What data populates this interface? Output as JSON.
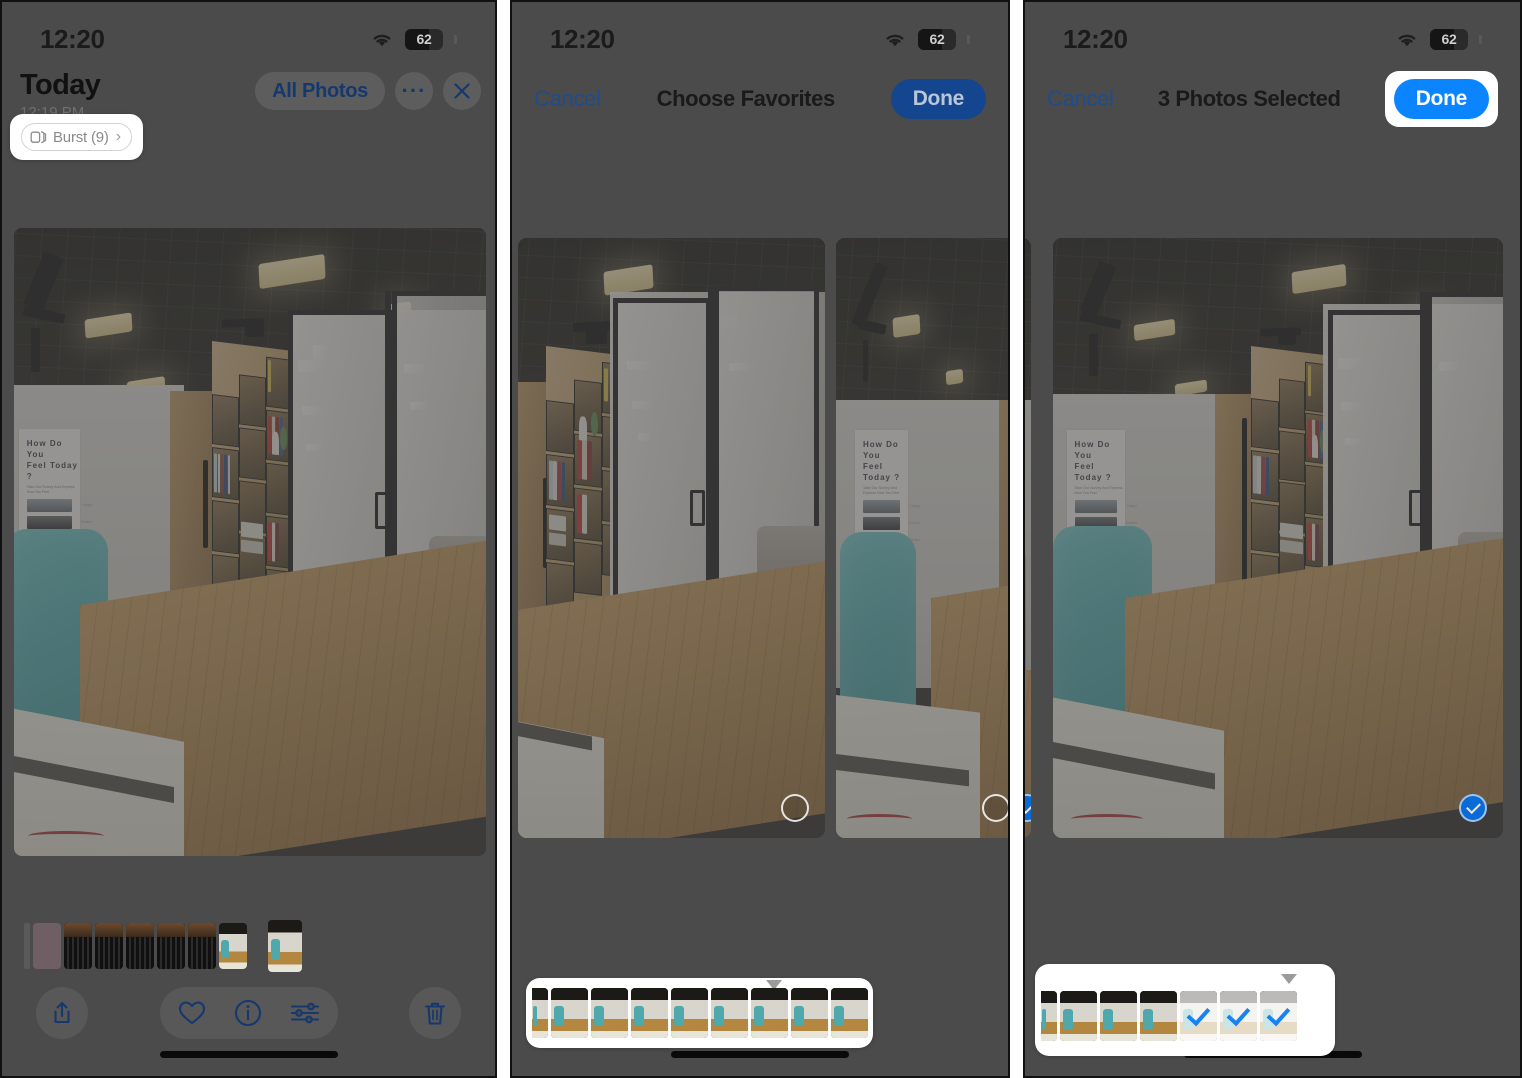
{
  "meta": {
    "app": "Photos",
    "platform": "iOS",
    "panel_count": 3
  },
  "status_bar": {
    "time": "12:20",
    "wifi_icon": "wifi-icon",
    "battery_icon": "battery-icon",
    "battery_level": "62"
  },
  "panel1": {
    "title": "Today",
    "subtitle": "12:19 PM",
    "all_photos_label": "All Photos",
    "more_label": "···",
    "close_label": "✕",
    "burst_badge": {
      "label": "Burst (9)",
      "icon": "burst-stack-icon",
      "chevron": "›",
      "highlighted": true
    },
    "toolbar": {
      "share_icon": "share-icon",
      "favorite_icon": "heart-icon",
      "info_icon": "info-icon",
      "adjust_icon": "adjust-sliders-icon",
      "delete_icon": "trash-icon"
    },
    "filmstrip_count": 9
  },
  "panel2": {
    "cancel_label": "Cancel",
    "title": "Choose Favorites",
    "done_label": "Done",
    "done_highlighted": false,
    "filmstrip_highlighted": true,
    "filmstrip_count": 9,
    "selection_state": "none-selected"
  },
  "panel3": {
    "cancel_label": "Cancel",
    "title": "3 Photos Selected",
    "done_label": "Done",
    "done_highlighted": true,
    "filmstrip_highlighted": true,
    "filmstrip_count": 7,
    "selected_count": 3,
    "selection_state": "three-selected"
  },
  "colors": {
    "accent_blue": "#0a84ff",
    "dimmed_blue": "#14458f",
    "link_blue": "#1d4c8f",
    "check_blue": "#1782f0",
    "backdrop": "#4b4b4b",
    "callout_white": "#ffffff",
    "teal_board": "#4faaad"
  },
  "photo_scene": {
    "poster_title": "How Do You\nFeel Today ?",
    "poster_subtitle": "Take Our Survey And Express How You Feel",
    "poster_labels": [
      "Happy",
      "Excited",
      "Tender"
    ],
    "description": "Office interior with suspended black grid ceiling, white wall poster, teal whiteboard, wooden cube bookshelf with books, glass sliding doors and wooden floor"
  }
}
